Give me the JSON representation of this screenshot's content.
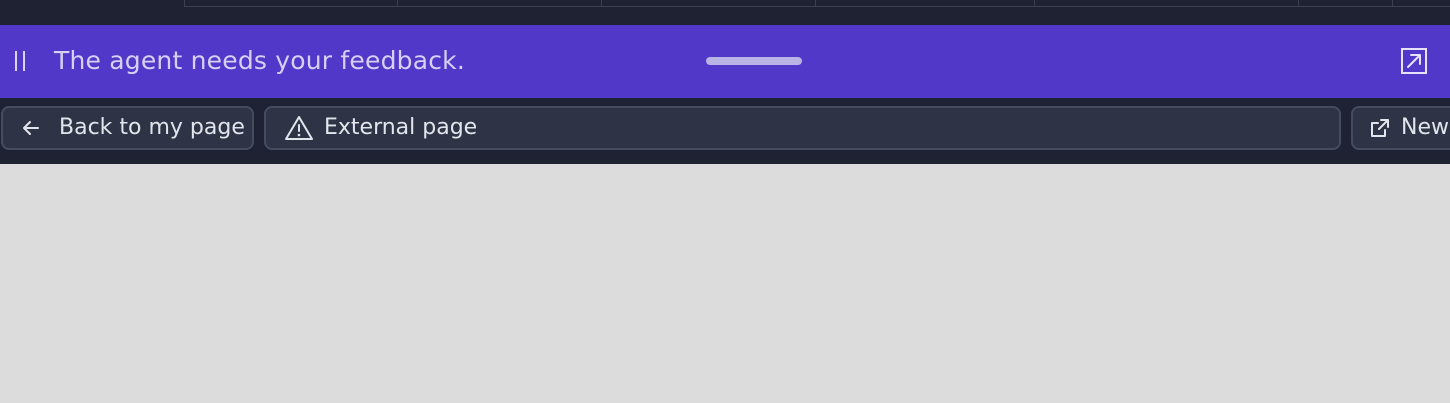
{
  "banner": {
    "message": "The agent needs your feedback.",
    "pause_icon": "pause-icon",
    "expand_icon": "expand-arrow-icon",
    "background_color": "#5138c9"
  },
  "nav": {
    "back_label": "Back to my page",
    "back_icon": "arrow-left-icon",
    "url_label": "External page",
    "url_icon": "warning-triangle-icon",
    "new_label": "New",
    "new_icon": "external-link-icon"
  }
}
